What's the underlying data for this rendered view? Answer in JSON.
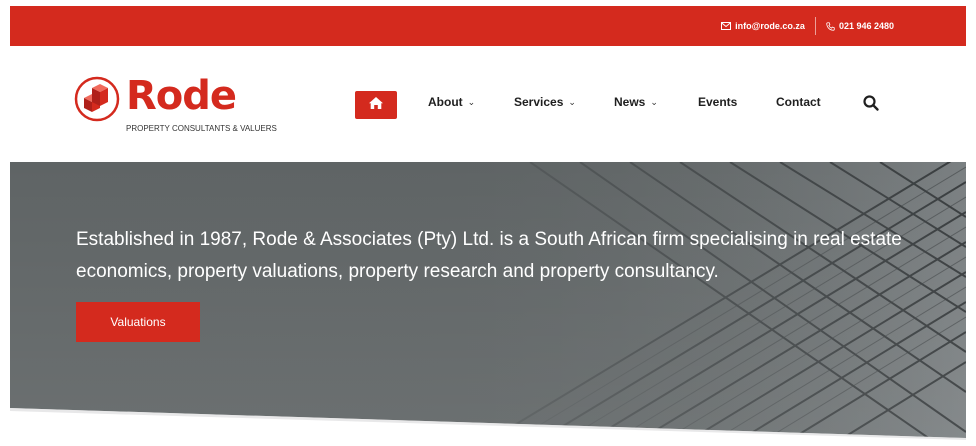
{
  "topbar": {
    "email": "info@rode.co.za",
    "email_icon": "envelope-icon",
    "phone": "021 946 2480",
    "phone_icon": "phone-icon",
    "background": "#d42a1e"
  },
  "brand": {
    "name": "Rode",
    "tagline": "PROPERTY CONSULTANTS & VALUERS",
    "logo_icon": "rode-logo-icon",
    "accent": "#d42a1e"
  },
  "nav": {
    "home_icon": "home-icon",
    "items": [
      {
        "label": "About",
        "dropdown": true
      },
      {
        "label": "Services",
        "dropdown": true
      },
      {
        "label": "News",
        "dropdown": true
      },
      {
        "label": "Events",
        "dropdown": false
      },
      {
        "label": "Contact",
        "dropdown": false
      }
    ],
    "dropdown_glyph": "⌄",
    "search_icon": "search-icon"
  },
  "hero": {
    "text": "Established in 1987, Rode & Associates (Pty) Ltd. is a South African firm specialising in real estate economics, property valuations, property research and property consultancy.",
    "button_label": "Valuations"
  }
}
